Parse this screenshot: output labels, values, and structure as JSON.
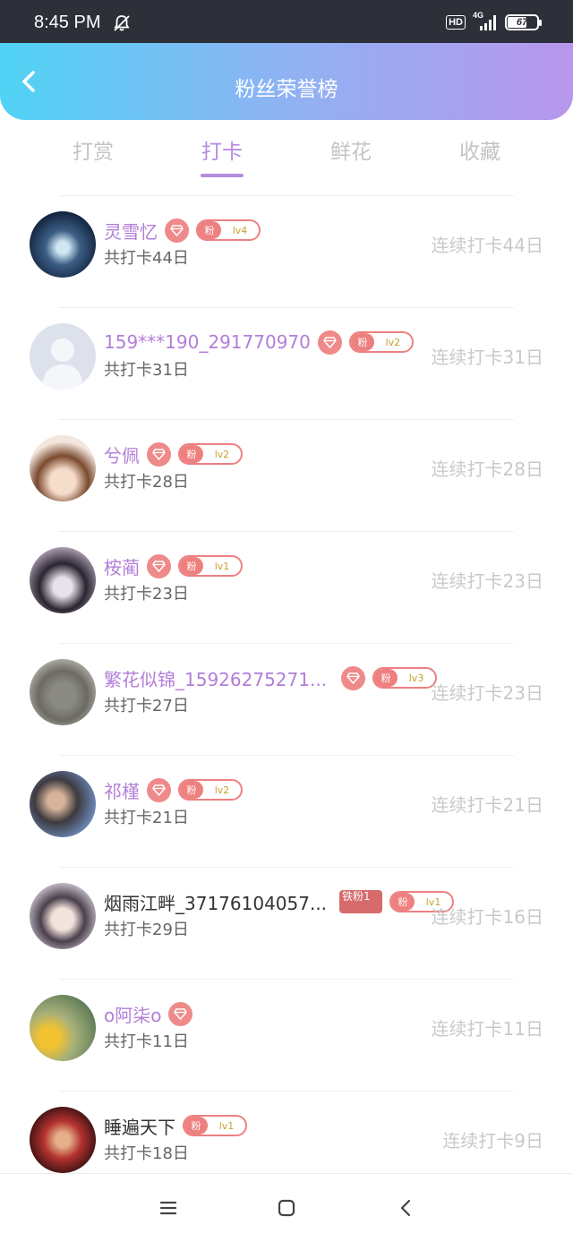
{
  "status_bar": {
    "time": "8:45 PM",
    "hd": "HD",
    "network": "4G",
    "battery": "67",
    "battery_level": 0.67
  },
  "header": {
    "title": "粉丝荣誉榜"
  },
  "tabs": [
    {
      "label": "打赏"
    },
    {
      "label": "打卡"
    },
    {
      "label": "鲜花"
    },
    {
      "label": "收藏"
    }
  ],
  "active_tab": 1,
  "rows": [
    {
      "name": "灵雪忆",
      "diamond": true,
      "badge_text": "粉",
      "level": "lv4",
      "total": "共打卡44日",
      "consecutive": "连续打卡44日"
    },
    {
      "name": "159***190_291770970",
      "diamond": true,
      "badge_text": "粉",
      "level": "lv2",
      "total": "共打卡31日",
      "consecutive": "连续打卡31日"
    },
    {
      "name": "兮佩",
      "diamond": true,
      "badge_text": "粉",
      "level": "lv2",
      "total": "共打卡28日",
      "consecutive": "连续打卡28日"
    },
    {
      "name": "桉蔺",
      "diamond": true,
      "badge_text": "粉",
      "level": "lv1",
      "total": "共打卡23日",
      "consecutive": "连续打卡23日"
    },
    {
      "name": "繁花似锦_15926275271...",
      "diamond": true,
      "badge_text": "粉",
      "level": "lv3",
      "total": "共打卡27日",
      "consecutive": "连续打卡23日"
    },
    {
      "name": "祁槿",
      "diamond": true,
      "badge_text": "粉",
      "level": "lv2",
      "total": "共打卡21日",
      "consecutive": "连续打卡21日"
    },
    {
      "name": "烟雨江畔_37176104057...",
      "diamond": false,
      "iron": "铁粉1",
      "badge_text": "粉",
      "level": "lv1",
      "total": "共打卡29日",
      "consecutive": "连续打卡16日"
    },
    {
      "name": "o阿柒o",
      "diamond": true,
      "total": "共打卡11日",
      "consecutive": "连续打卡11日"
    },
    {
      "name": "睡遍天下",
      "diamond": false,
      "badge_text": "粉",
      "level": "lv1",
      "total": "共打卡18日",
      "consecutive": "连续打卡9日"
    }
  ],
  "colors": {
    "accent": "#b58ce0",
    "header_start": "#4fd3f4",
    "header_end": "#b897ec",
    "badge": "#ee8080"
  }
}
